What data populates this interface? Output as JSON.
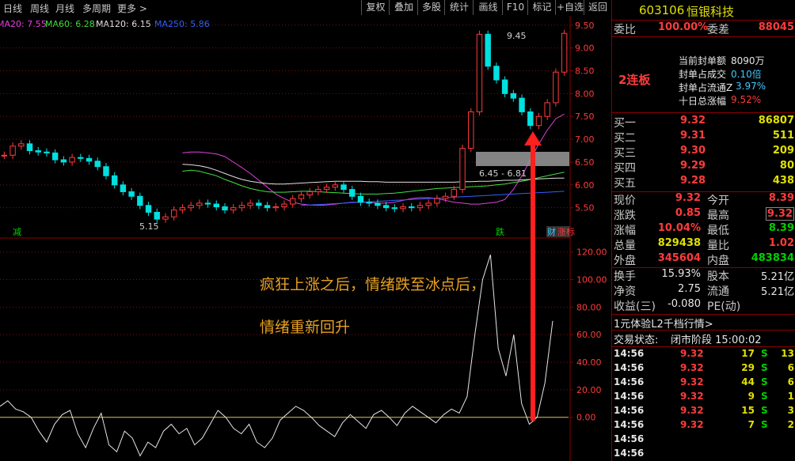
{
  "toolbar": {
    "left": [
      "日线",
      "周线",
      "月线",
      "多周期",
      "更多 >"
    ],
    "right": [
      "复权",
      "叠加",
      "多股",
      "统计",
      "画线",
      "F10",
      "标记",
      "+自选",
      "返回"
    ]
  },
  "ma_legend": [
    {
      "text": "MA20: 7.55",
      "color": "#e040e0"
    },
    {
      "text": "MA60: 6.28",
      "color": "#40e040"
    },
    {
      "text": "MA120: 6.15",
      "color": "#e0e0e0"
    },
    {
      "text": "MA250: 5.86",
      "color": "#3060ff"
    }
  ],
  "annotations": {
    "high": "9.45",
    "low": "5.15",
    "box_range": "6.45 - 6.81",
    "mark_left": "减",
    "mark_mid": "跌",
    "mark_right": "财",
    "mark_right2": "涨标",
    "text_line1": "疯狂上涨之后，情绪跌至冰点后，",
    "text_line2": "情绪重新回升"
  },
  "chart_data": [
    {
      "type": "candlestick",
      "title": "",
      "yticks": [
        "9.50",
        "9.00",
        "8.50",
        "8.00",
        "7.50",
        "7.00",
        "6.50",
        "6.00",
        "5.50"
      ],
      "ylim": [
        5.2,
        9.6
      ],
      "x_count": 60,
      "close": [
        6.65,
        6.85,
        6.9,
        6.75,
        6.72,
        6.7,
        6.55,
        6.5,
        6.6,
        6.58,
        6.52,
        6.4,
        6.2,
        6.0,
        5.85,
        5.75,
        5.55,
        5.4,
        5.25,
        5.3,
        5.45,
        5.5,
        5.55,
        5.6,
        5.58,
        5.52,
        5.45,
        5.5,
        5.55,
        5.6,
        5.55,
        5.5,
        5.52,
        5.58,
        5.7,
        5.78,
        5.85,
        5.9,
        5.95,
        6.0,
        5.9,
        5.75,
        5.62,
        5.6,
        5.55,
        5.5,
        5.48,
        5.52,
        5.5,
        5.55,
        5.6,
        5.7,
        5.75,
        5.9,
        6.8,
        7.6,
        9.3,
        8.6,
        8.3,
        8.0,
        7.9,
        7.6,
        7.3,
        7.5,
        7.8,
        8.47,
        9.32
      ],
      "ma_series": [
        {
          "color": "#e040e0",
          "values": [
            6.7,
            6.72,
            6.72,
            6.7,
            6.68,
            6.62,
            6.5,
            6.38,
            6.25,
            6.1,
            5.95,
            5.8,
            5.7,
            5.62,
            5.58,
            5.56,
            5.55,
            5.56,
            5.58,
            5.6,
            5.62,
            5.62,
            5.62,
            5.6,
            5.6,
            5.62,
            5.66,
            5.7,
            5.72,
            5.72,
            5.7,
            5.66,
            5.62,
            5.6,
            5.58,
            5.58,
            5.6,
            5.62,
            5.68,
            5.9,
            6.2,
            6.55,
            6.9,
            7.2,
            7.45,
            7.55
          ]
        },
        {
          "color": "#40e040",
          "values": [
            6.3,
            6.32,
            6.3,
            6.25,
            6.2,
            6.12,
            6.05,
            5.98,
            5.92,
            5.88,
            5.85,
            5.84,
            5.84,
            5.85,
            5.86,
            5.86,
            5.85,
            5.84,
            5.83,
            5.82,
            5.81,
            5.8,
            5.8,
            5.8,
            5.81,
            5.82,
            5.84,
            5.86,
            5.88,
            5.9,
            5.92,
            5.93,
            5.94,
            5.95,
            5.96,
            5.97,
            5.98,
            6.0,
            6.02,
            6.05,
            6.08,
            6.12,
            6.16,
            6.2,
            6.24,
            6.28
          ]
        },
        {
          "color": "#e0e0e0",
          "values": [
            6.45,
            6.44,
            6.42,
            6.38,
            6.32,
            6.25,
            6.18,
            6.12,
            6.08,
            6.05,
            6.03,
            6.02,
            6.02,
            6.03,
            6.04,
            6.05,
            6.06,
            6.07,
            6.08,
            6.08,
            6.08,
            6.08,
            6.07,
            6.07,
            6.06,
            6.06,
            6.06,
            6.06,
            6.06,
            6.06,
            6.06,
            6.06,
            6.06,
            6.07,
            6.07,
            6.08,
            6.08,
            6.09,
            6.1,
            6.1,
            6.11,
            6.12,
            6.13,
            6.14,
            6.15,
            6.15
          ]
        },
        {
          "color": "#3060ff",
          "values": [
            5.55,
            5.56,
            5.57,
            5.58,
            5.59,
            5.6,
            5.61,
            5.62,
            5.63,
            5.64,
            5.65,
            5.66,
            5.67,
            5.68,
            5.69,
            5.7,
            5.71,
            5.72,
            5.73,
            5.74,
            5.75,
            5.76,
            5.77,
            5.78,
            5.79,
            5.8,
            5.81,
            5.82,
            5.83,
            5.84,
            5.85,
            5.86
          ]
        }
      ]
    },
    {
      "type": "line",
      "title": "",
      "yticks": [
        "120.00",
        "100.00",
        "80.00",
        "60.00",
        "40.00",
        "20.00",
        "0.00"
      ],
      "ylim": [
        -30,
        125
      ],
      "series": [
        {
          "values": [
            8,
            12,
            6,
            4,
            0,
            -10,
            -18,
            -5,
            2,
            5,
            -12,
            -22,
            -8,
            3,
            -20,
            -25,
            -10,
            -15,
            -28,
            -18,
            -22,
            -10,
            -5,
            -12,
            -8,
            -20,
            -15,
            -5,
            5,
            0,
            -8,
            -12,
            -5,
            -18,
            -22,
            -15,
            -2,
            3,
            8,
            5,
            0,
            -6,
            -10,
            -14,
            -4,
            2,
            -3,
            -8,
            2,
            5,
            0,
            -6,
            3,
            8,
            4,
            0,
            -4,
            2,
            6,
            3,
            15,
            60,
            100,
            118,
            50,
            30,
            60,
            10,
            -5,
            0,
            25,
            70
          ]
        }
      ]
    }
  ],
  "quote": {
    "code": "603106",
    "name": "恒银科技",
    "webi_label": "委比",
    "webi_value": "100.00%",
    "weicha_label": "委差",
    "weicha_value": "88045",
    "lianban": "2连板",
    "fengdan": [
      {
        "label": "当前封单额",
        "value": "8090万"
      },
      {
        "label": "封单占成交",
        "value": "0.10倍"
      },
      {
        "label": "封单占流通Z",
        "value": "3.97%"
      },
      {
        "label": "十日总涨幅",
        "value": "9.52%"
      }
    ],
    "buys": [
      {
        "label": "买一",
        "price": "9.32",
        "vol": "86807"
      },
      {
        "label": "买二",
        "price": "9.31",
        "vol": "511"
      },
      {
        "label": "买三",
        "price": "9.30",
        "vol": "209"
      },
      {
        "label": "买四",
        "price": "9.29",
        "vol": "80"
      },
      {
        "label": "买五",
        "price": "9.28",
        "vol": "438"
      }
    ],
    "stats": [
      {
        "l1": "现价",
        "v1": "9.32",
        "l2": "今开",
        "v2": "8.39"
      },
      {
        "l1": "涨跌",
        "v1": "0.85",
        "l2": "最高",
        "v2": "9.32"
      },
      {
        "l1": "涨幅",
        "v1": "10.04%",
        "l2": "最低",
        "v2": "8.39"
      },
      {
        "l1": "总量",
        "v1": "829438",
        "l2": "量比",
        "v2": "1.02"
      },
      {
        "l1": "外盘",
        "v1": "345604",
        "l2": "内盘",
        "v2": "483834"
      }
    ],
    "stats2": [
      {
        "l1": "换手",
        "v1": "15.93%",
        "l2": "股本",
        "v2": "5.21亿"
      },
      {
        "l1": "净资",
        "v1": "2.75",
        "l2": "流通",
        "v2": "5.21亿"
      },
      {
        "l1": "收益(三)",
        "v1": "-0.080",
        "l2": "PE(动)",
        "v2": ""
      }
    ],
    "promo": "1元体验L2千档行情>",
    "trade_status_label": "交易状态:",
    "trade_status": "闭市阶段 15:00:02",
    "ticks": [
      {
        "time": "14:56",
        "price": "9.32",
        "vol": "17",
        "side": "S",
        "n": "13"
      },
      {
        "time": "14:56",
        "price": "9.32",
        "vol": "29",
        "side": "S",
        "n": "6"
      },
      {
        "time": "14:56",
        "price": "9.32",
        "vol": "44",
        "side": "S",
        "n": "6"
      },
      {
        "time": "14:56",
        "price": "9.32",
        "vol": "9",
        "side": "S",
        "n": "1"
      },
      {
        "time": "14:56",
        "price": "9.32",
        "vol": "15",
        "side": "S",
        "n": "3"
      },
      {
        "time": "14:56",
        "price": "9.32",
        "vol": "7",
        "side": "S",
        "n": "2"
      },
      {
        "time": "14:56",
        "price": "",
        "vol": "",
        "side": "",
        "n": ""
      },
      {
        "time": "14:56",
        "price": "",
        "vol": "",
        "side": "",
        "n": ""
      }
    ]
  }
}
